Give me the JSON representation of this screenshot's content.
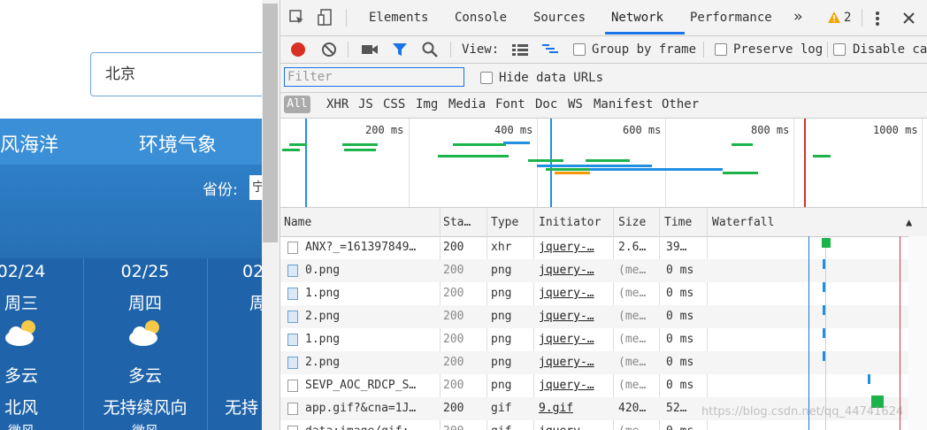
{
  "page": {
    "search_value": "北京",
    "nav": [
      "风海洋",
      "环境气象"
    ],
    "province_label": "省份:",
    "province_value": "宁",
    "days": [
      {
        "date": "02/24",
        "weekday": "周三",
        "cond": "多云",
        "wind": "北风",
        "extra": "微风"
      },
      {
        "date": "02/25",
        "weekday": "周四",
        "cond": "多云",
        "wind": "无持续风向",
        "extra": "微风"
      },
      {
        "date": "02",
        "weekday": "周",
        "cond": "",
        "wind": "无持",
        "extra": ""
      }
    ]
  },
  "devtools": {
    "tabs": [
      "Elements",
      "Console",
      "Sources",
      "Network",
      "Performance"
    ],
    "more": "»",
    "warnings": "2",
    "toolbar": {
      "view": "View:",
      "group_by_frame": "Group by frame",
      "preserve_log": "Preserve log",
      "disable_cache": "Disable ca"
    },
    "filter_placeholder": "Filter",
    "hide_data_urls": "Hide data URLs",
    "types": [
      "All",
      "XHR",
      "JS",
      "CSS",
      "Img",
      "Media",
      "Font",
      "Doc",
      "WS",
      "Manifest",
      "Other"
    ],
    "overview_labels": [
      "200 ms",
      "400 ms",
      "600 ms",
      "800 ms",
      "1000 ms"
    ],
    "columns": [
      "Name",
      "Sta…",
      "Type",
      "Initiator",
      "Size",
      "Time",
      "Waterfall"
    ],
    "sort_icon": "▲",
    "rows": [
      {
        "name": "ANX?_=161397849…",
        "status": "200",
        "type": "xhr",
        "initiator": "jquery-…",
        "size": "2.6…",
        "time": "39…",
        "dim": false,
        "icon": "doc"
      },
      {
        "name": "0.png",
        "status": "200",
        "type": "png",
        "initiator": "jquery-…",
        "size": "(me…",
        "time": "0 ms",
        "dim": true,
        "icon": "img"
      },
      {
        "name": "1.png",
        "status": "200",
        "type": "png",
        "initiator": "jquery-…",
        "size": "(me…",
        "time": "0 ms",
        "dim": true,
        "icon": "img"
      },
      {
        "name": "2.png",
        "status": "200",
        "type": "png",
        "initiator": "jquery-…",
        "size": "(me…",
        "time": "0 ms",
        "dim": true,
        "icon": "img"
      },
      {
        "name": "1.png",
        "status": "200",
        "type": "png",
        "initiator": "jquery-…",
        "size": "(me…",
        "time": "0 ms",
        "dim": true,
        "icon": "img"
      },
      {
        "name": "2.png",
        "status": "200",
        "type": "png",
        "initiator": "jquery-…",
        "size": "(me…",
        "time": "0 ms",
        "dim": true,
        "icon": "img"
      },
      {
        "name": "SEVP_AOC_RDCP_S…",
        "status": "200",
        "type": "png",
        "initiator": "jquery-…",
        "size": "(me…",
        "time": "0 ms",
        "dim": true,
        "icon": "doc"
      },
      {
        "name": "app.gif?&cna=1J…",
        "status": "200",
        "type": "gif",
        "initiator": "9.gif",
        "size": "420…",
        "time": "52…",
        "dim": false,
        "icon": "doc"
      },
      {
        "name": "data:image/gif;…",
        "status": "200",
        "type": "gif",
        "initiator": "jquery-…",
        "size": "(me…",
        "time": "0 ms",
        "dim": true,
        "icon": "doc"
      }
    ],
    "watermark": "https://blog.csdn.net/qq_44741624",
    "colors": {
      "accent": "#1a73e8",
      "record": "#d93025",
      "green": "#1db34b",
      "blue_bar": "#1f8fe0"
    }
  }
}
